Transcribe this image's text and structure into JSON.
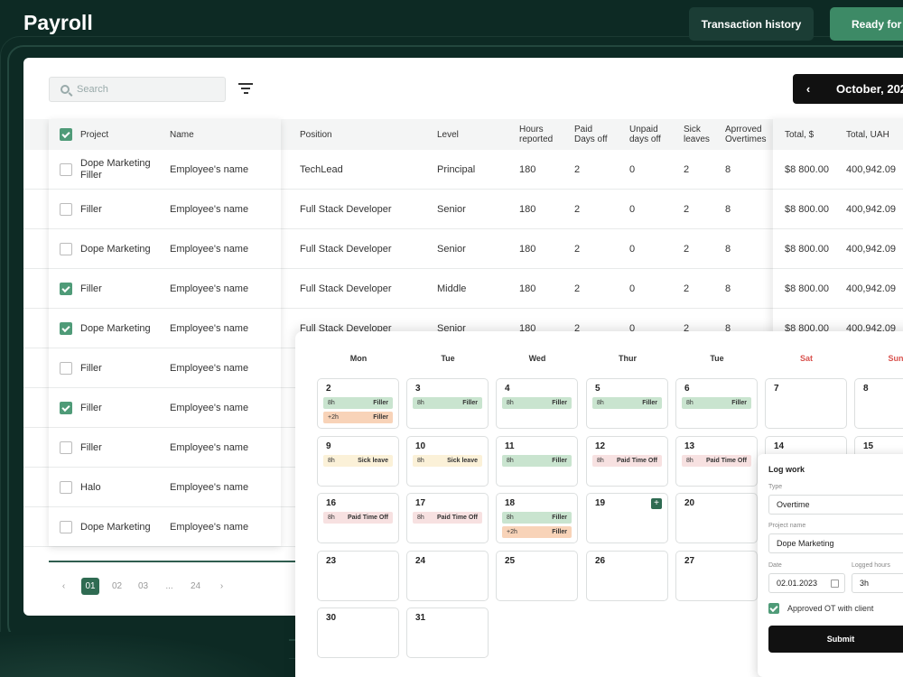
{
  "header": {
    "title": "Payroll",
    "history_label": "Transaction history",
    "ready_label": "Ready for i"
  },
  "toolbar": {
    "search_placeholder": "Search",
    "month_label": "October, 202"
  },
  "table": {
    "headers": {
      "project": "Project",
      "name": "Name",
      "position": "Position",
      "level": "Level",
      "hours_1": "Hours",
      "hours_2": "reported",
      "paid_1": "Paid",
      "paid_2": "Days off",
      "unpaid_1": "Unpaid",
      "unpaid_2": "days off",
      "sick_1": "Sick",
      "sick_2": "leaves",
      "ot_1": "Aprroved",
      "ot_2": "Overtimes",
      "total_usd": "Total, $",
      "total_uah": "Total, UAH"
    },
    "rows": [
      {
        "checked": false,
        "project": "Dope Marketing Filler",
        "name": "Employee's name",
        "position": "TechLead",
        "level": "Principal",
        "hours": "180",
        "paid": "2",
        "unpaid": "0",
        "sick": "2",
        "ot": "8",
        "usd": "$8 800.00",
        "uah": "400,942.09"
      },
      {
        "checked": false,
        "project": "Filler",
        "name": "Employee's name",
        "position": "Full Stack Developer",
        "level": "Senior",
        "hours": "180",
        "paid": "2",
        "unpaid": "0",
        "sick": "2",
        "ot": "8",
        "usd": "$8 800.00",
        "uah": "400,942.09"
      },
      {
        "checked": false,
        "project": "Dope Marketing",
        "name": "Employee's name",
        "position": "Full Stack Developer",
        "level": "Senior",
        "hours": "180",
        "paid": "2",
        "unpaid": "0",
        "sick": "2",
        "ot": "8",
        "usd": "$8 800.00",
        "uah": "400,942.09"
      },
      {
        "checked": true,
        "project": "Filler",
        "name": "Employee's name",
        "position": "Full Stack Developer",
        "level": "Middle",
        "hours": "180",
        "paid": "2",
        "unpaid": "0",
        "sick": "2",
        "ot": "8",
        "usd": "$8 800.00",
        "uah": "400,942.09"
      },
      {
        "checked": true,
        "project": "Dope Marketing",
        "name": "Employee's name",
        "position": "Full Stack Developer",
        "level": "Senior",
        "hours": "180",
        "paid": "2",
        "unpaid": "0",
        "sick": "2",
        "ot": "8",
        "usd": "$8 800.00",
        "uah": "400,942.09"
      },
      {
        "checked": false,
        "project": "Filler",
        "name": "Employee's name"
      },
      {
        "checked": true,
        "project": "Filler",
        "name": "Employee's name"
      },
      {
        "checked": false,
        "project": "Filler",
        "name": "Employee's name"
      },
      {
        "checked": false,
        "project": "Halo",
        "name": "Employee's name"
      },
      {
        "checked": false,
        "project": "Dope Marketing",
        "name": "Employee's name"
      }
    ]
  },
  "pagination": {
    "prev": "‹",
    "pages": [
      "01",
      "02",
      "03",
      "...",
      "24"
    ],
    "next": "›"
  },
  "calendar": {
    "weekdays": [
      "Mon",
      "Tue",
      "Wed",
      "Thur",
      "Tue",
      "Sat",
      "Sun"
    ],
    "weeks": [
      [
        {
          "day": "2",
          "tags": [
            {
              "k": "g",
              "h": "8h",
              "t": "Filler"
            },
            {
              "k": "o",
              "h": "+2h",
              "t": "Filler"
            }
          ]
        },
        {
          "day": "3",
          "tags": [
            {
              "k": "g",
              "h": "8h",
              "t": "Filler"
            }
          ]
        },
        {
          "day": "4",
          "tags": [
            {
              "k": "g",
              "h": "8h",
              "t": "Filler"
            }
          ]
        },
        {
          "day": "5",
          "tags": [
            {
              "k": "g",
              "h": "8h",
              "t": "Filler"
            }
          ]
        },
        {
          "day": "6",
          "tags": [
            {
              "k": "g",
              "h": "8h",
              "t": "Filler"
            }
          ]
        },
        {
          "day": "7",
          "tags": []
        },
        {
          "day": "8",
          "tags": []
        }
      ],
      [
        {
          "day": "9",
          "tags": [
            {
              "k": "y",
              "h": "8h",
              "t": "Sick leave"
            }
          ]
        },
        {
          "day": "10",
          "tags": [
            {
              "k": "y",
              "h": "8h",
              "t": "Sick leave"
            }
          ]
        },
        {
          "day": "11",
          "tags": [
            {
              "k": "g",
              "h": "8h",
              "t": "Filler"
            }
          ]
        },
        {
          "day": "12",
          "tags": [
            {
              "k": "p",
              "h": "8h",
              "t": "Paid Time Off"
            }
          ]
        },
        {
          "day": "13",
          "tags": [
            {
              "k": "p",
              "h": "8h",
              "t": "Paid Time Off"
            }
          ]
        },
        {
          "day": "14",
          "tags": []
        },
        {
          "day": "15",
          "tags": []
        }
      ],
      [
        {
          "day": "16",
          "tags": [
            {
              "k": "p",
              "h": "8h",
              "t": "Paid Time Off"
            }
          ]
        },
        {
          "day": "17",
          "tags": [
            {
              "k": "p",
              "h": "8h",
              "t": "Paid Time Off"
            }
          ]
        },
        {
          "day": "18",
          "tags": [
            {
              "k": "g",
              "h": "8h",
              "t": "Filler"
            },
            {
              "k": "o",
              "h": "+2h",
              "t": "Filler"
            }
          ]
        },
        {
          "day": "19",
          "tags": [],
          "plus": "+"
        },
        {
          "day": "20",
          "tags": []
        }
      ],
      [
        {
          "day": "23",
          "tags": []
        },
        {
          "day": "24",
          "tags": []
        },
        {
          "day": "25",
          "tags": []
        },
        {
          "day": "26",
          "tags": []
        },
        {
          "day": "27",
          "tags": []
        }
      ],
      [
        {
          "day": "30",
          "tags": []
        },
        {
          "day": "31",
          "tags": []
        }
      ]
    ]
  },
  "log_work": {
    "title": "Log work",
    "type_label": "Type",
    "type_value": "Overtime",
    "project_label": "Project name",
    "project_value": "Dope Marketing",
    "date_label": "Date",
    "date_value": "02.01.2023",
    "hours_label": "Logged hours",
    "hours_value": "3h",
    "approved_label": "Approved OT with client",
    "approved_checked": true,
    "submit_label": "Submit"
  },
  "colors": {
    "accent": "#2f6b52",
    "bg": "#0d2a24",
    "weekend": "#d9534f"
  }
}
